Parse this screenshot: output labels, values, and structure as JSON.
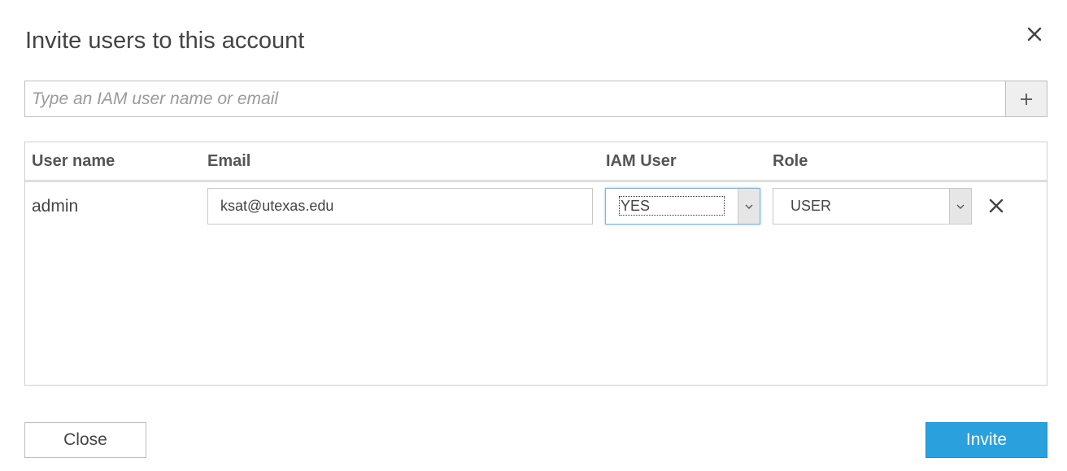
{
  "dialog": {
    "title": "Invite users to this account"
  },
  "search": {
    "placeholder": "Type an IAM user name or email",
    "value": ""
  },
  "icons": {
    "close": "close-icon",
    "add": "plus-icon",
    "dropdown": "chevron-down-icon",
    "remove": "remove-icon"
  },
  "table": {
    "columns": [
      "User name",
      "Email",
      "IAM User",
      "Role"
    ],
    "rows": [
      {
        "user_name": "admin",
        "email": "ksat@utexas.edu",
        "iam_user": "YES",
        "role": "USER"
      }
    ]
  },
  "footer": {
    "close_label": "Close",
    "invite_label": "Invite"
  },
  "colors": {
    "primary": "#2aa0dd",
    "focus": "#78b3e0"
  }
}
